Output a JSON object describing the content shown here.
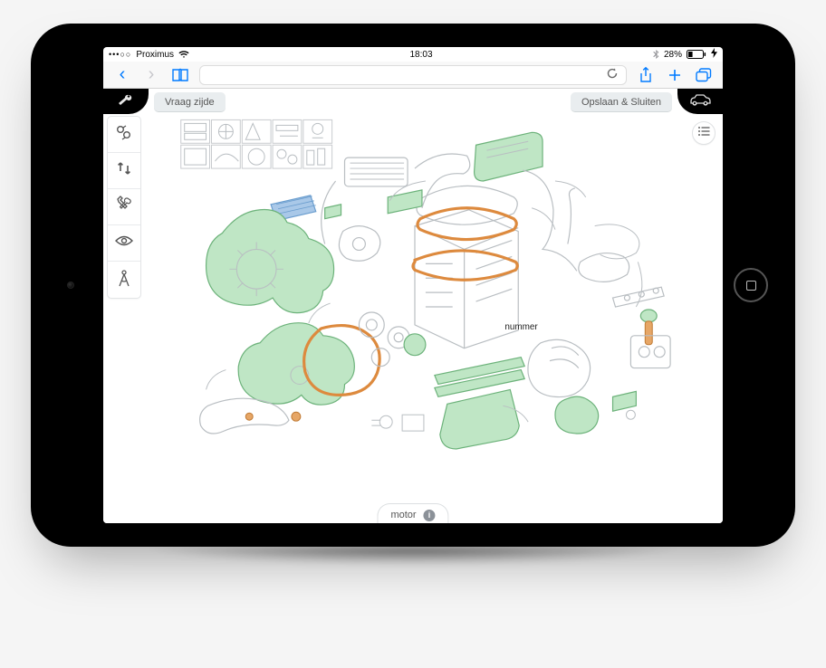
{
  "status": {
    "signal_glyph": "•••○○",
    "carrier": "Proximus",
    "time": "18:03",
    "battery_text": "28%"
  },
  "app_header": {
    "ask_side_label": "Vraag zijde",
    "save_close_label": "Opslaan & Sluiten"
  },
  "canvas": {
    "tooltip_text": "nummer"
  },
  "bottom": {
    "title": "motor"
  },
  "icons": {
    "back": "‹",
    "forward": "›",
    "list_glyph": "≣",
    "info_glyph": "i"
  }
}
